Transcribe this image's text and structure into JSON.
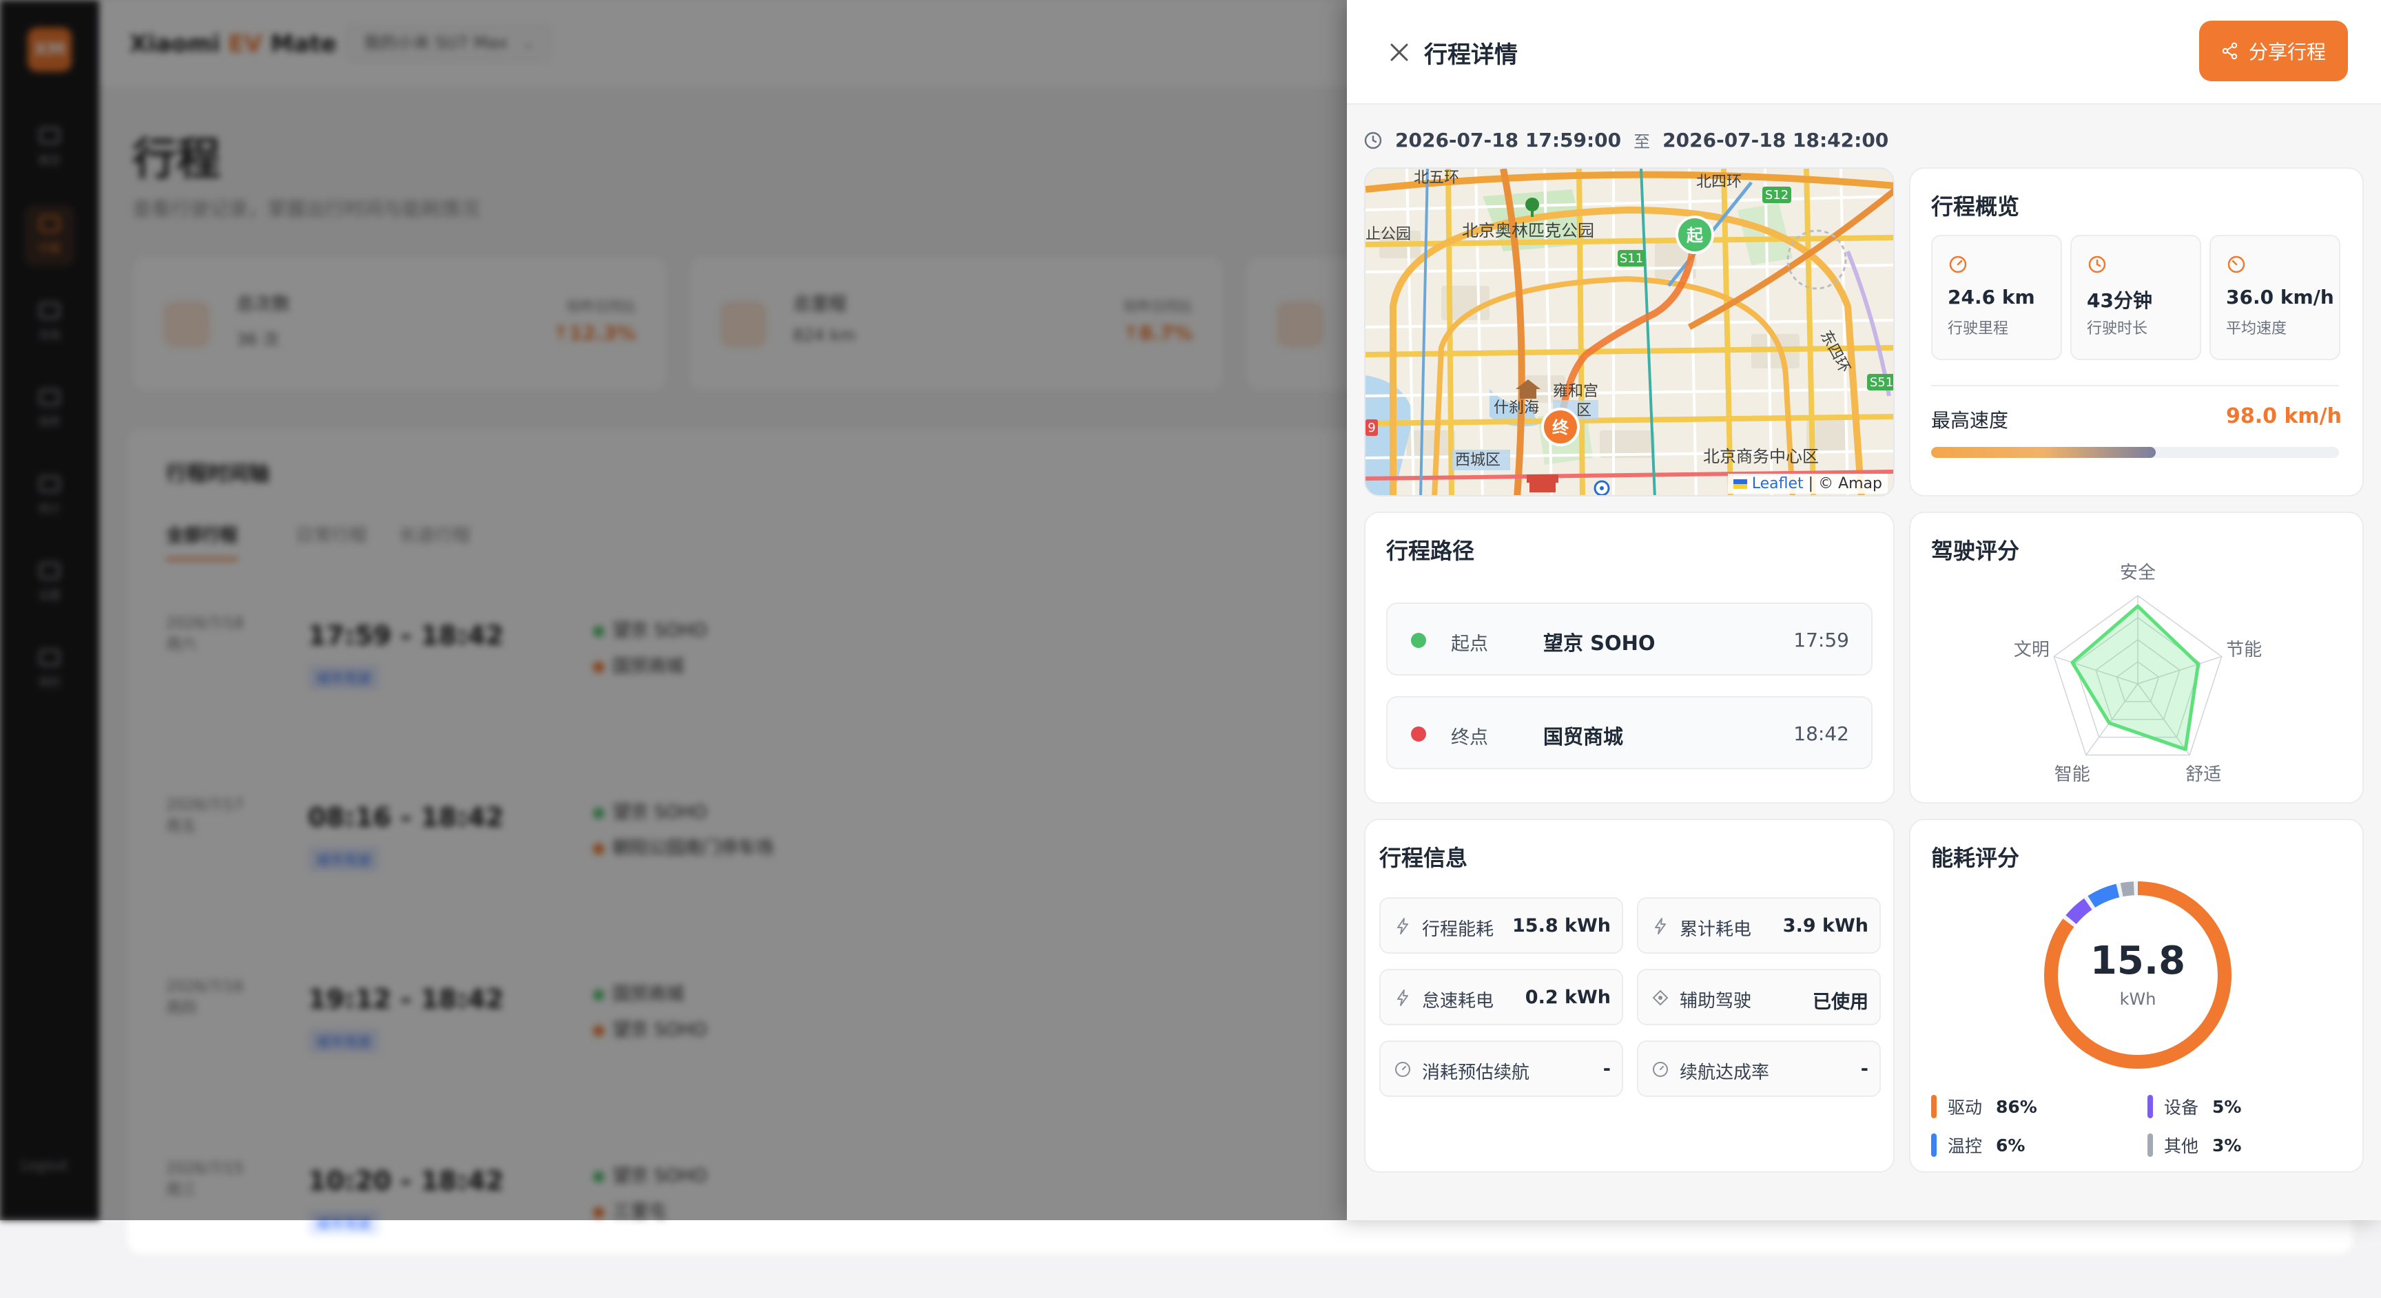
{
  "sidebar": {
    "logo_text": "XM",
    "items": [
      {
        "label": "概览"
      },
      {
        "label": "行程"
      },
      {
        "label": "充电"
      },
      {
        "label": "保养"
      },
      {
        "label": "统计"
      },
      {
        "label": "设置"
      },
      {
        "label": "我的"
      }
    ],
    "logout_label": "Logout"
  },
  "background": {
    "brand_name": "Xiaomi",
    "brand_accent": "EV",
    "brand_suffix": "Mate",
    "model_select": "我的小米 SU7 Max",
    "page_title": "行程",
    "page_subtitle": "查看行驶记录，掌握出行时间与能耗情况",
    "stats": [
      {
        "name": "总次数",
        "value": "36 次",
        "compare": "较昨日同比",
        "pct": "↑12.3%"
      },
      {
        "name": "总里程",
        "value": "824 km",
        "compare": "较昨日同比",
        "pct": "↑8.7%"
      }
    ],
    "list_title": "行程时间轴",
    "tabs": [
      "全部行程",
      "日常行程",
      "长途行程"
    ],
    "trips": [
      {
        "date": "2026/7/18",
        "weekday": "周六",
        "time": "17:59 - 18:42",
        "tag": "城市驾驶",
        "from": "望京 SOHO",
        "to": "国贸商城"
      },
      {
        "date": "2026/7/17",
        "weekday": "周五",
        "time": "08:16 - 18:42",
        "tag": "城市驾驶",
        "from": "望京 SOHO",
        "to": "朝阳公园南门停车场"
      },
      {
        "date": "2026/7/16",
        "weekday": "周四",
        "time": "19:12 - 18:42",
        "tag": "城市驾驶",
        "from": "国贸商城",
        "to": "望京 SOHO"
      },
      {
        "date": "2026/7/15",
        "weekday": "周三",
        "time": "10:20 - 18:42",
        "tag": "城市驾驶",
        "from": "望京 SOHO",
        "to": "三里屯"
      }
    ]
  },
  "drawer": {
    "title": "行程详情",
    "share_label": "分享行程",
    "start_time": "2026-07-18 17:59:00",
    "to_label": "至",
    "end_time": "2026-07-18 18:42:00",
    "map": {
      "labels": {
        "beiwuhuan": "北五环",
        "beisihuan": "北四环",
        "olympic_park": "北京奥林匹克公园",
        "park_left": "止公园",
        "yonghegong": "雍和宫",
        "shichahai": "什刹海",
        "district": "区",
        "xicheng": "西城区",
        "cbd": "北京商务中心区",
        "dongsihuan": "东四环",
        "s11": "S11",
        "s12": "S12",
        "s51": "S51",
        "g9": "9",
        "start_marker": "起",
        "end_marker": "终"
      },
      "credit_leaflet": "Leaflet",
      "credit_sep": "|",
      "credit_amap": "© Amap"
    },
    "overview": {
      "title": "行程概览",
      "items": [
        {
          "value": "24.6 km",
          "label": "行驶里程",
          "icon": "gauge-icon"
        },
        {
          "value": "43分钟",
          "label": "行驶时长",
          "icon": "clock-icon"
        },
        {
          "value": "36.0 km/h",
          "label": "平均速度",
          "icon": "speedometer-icon"
        }
      ],
      "max_speed_label": "最高速度",
      "max_speed_value": "98.0 km/h",
      "max_speed_fraction": 0.55
    },
    "route": {
      "title": "行程路径",
      "start": {
        "kind": "起点",
        "place": "望京 SOHO",
        "time": "17:59",
        "color": "#4cbf6b"
      },
      "end": {
        "kind": "终点",
        "place": "国贸商城",
        "time": "18:42",
        "color": "#e5484d"
      }
    },
    "driving_score": {
      "title": "驾驶评分",
      "axes": [
        "安全",
        "节能",
        "舒适",
        "智能",
        "文明"
      ],
      "values": [
        0.88,
        0.72,
        0.92,
        0.55,
        0.78
      ],
      "color": "#5ee07a"
    },
    "trip_info": {
      "title": "行程信息",
      "items": [
        {
          "label": "行程能耗",
          "value": "15.8 kWh",
          "icon": "bolt-icon"
        },
        {
          "label": "累计耗电",
          "value": "3.9 kWh",
          "icon": "bolt-icon"
        },
        {
          "label": "怠速耗电",
          "value": "0.2 kWh",
          "icon": "bolt-icon"
        },
        {
          "label": "辅助驾驶",
          "value": "已使用",
          "icon": "target-icon"
        },
        {
          "label": "消耗预估续航",
          "value": "-",
          "icon": "gauge-icon"
        },
        {
          "label": "续航达成率",
          "value": "-",
          "icon": "gauge-icon"
        }
      ]
    },
    "energy": {
      "title": "能耗评分",
      "total": "15.8",
      "unit": "kWh",
      "segments": [
        {
          "name": "驱动",
          "value": "86%",
          "pct": 86,
          "color": "#f0782f"
        },
        {
          "name": "设备",
          "value": "5%",
          "pct": 5,
          "color": "#7c5cf5"
        },
        {
          "name": "温控",
          "value": "6%",
          "pct": 6,
          "color": "#3b82f6"
        },
        {
          "name": "其他",
          "value": "3%",
          "pct": 3,
          "color": "#a3a9b5"
        }
      ]
    }
  }
}
